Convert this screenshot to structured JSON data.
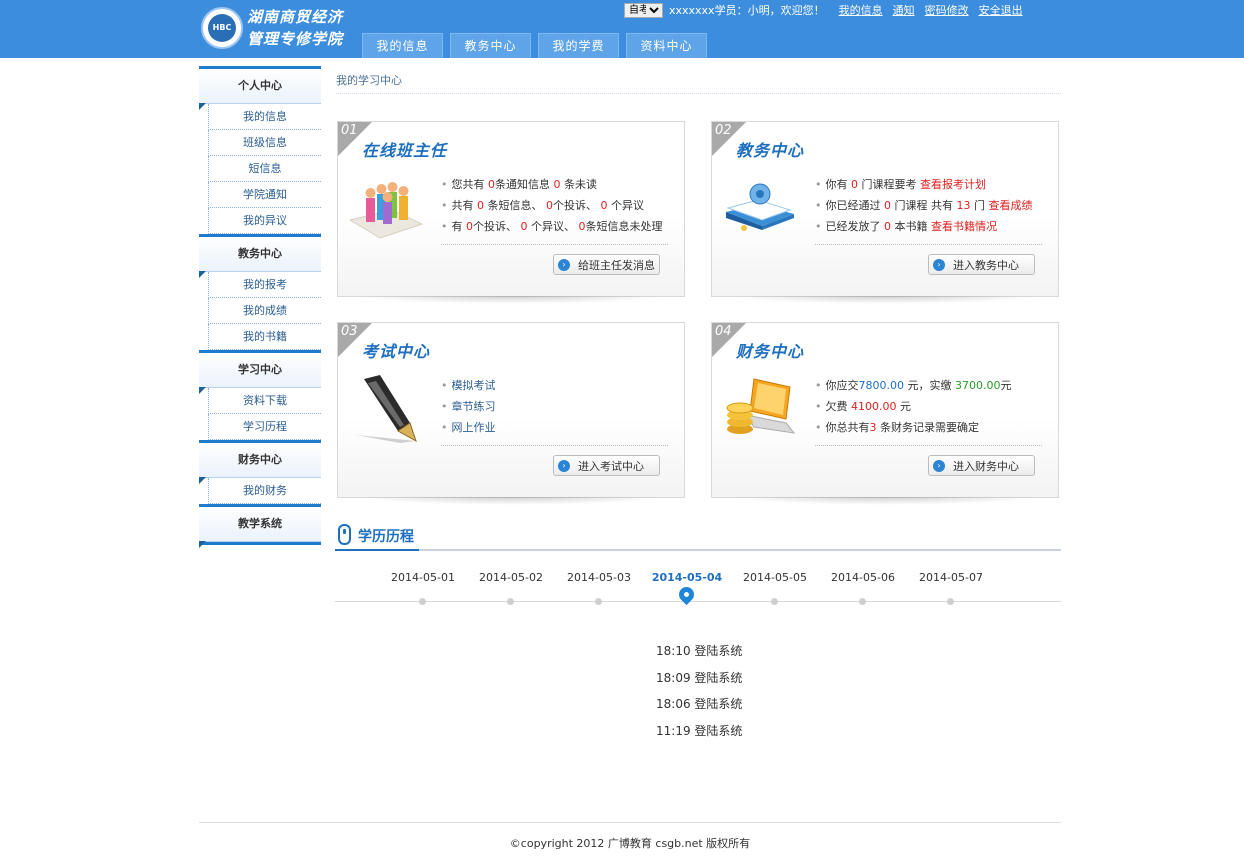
{
  "header": {
    "logo_badge": "HBC",
    "logo_title": "湖南商贸经济",
    "logo_subtitle": "管理专修学院",
    "exam_select": "自考",
    "greeting": "xxxxxxx学员：小明，欢迎您！",
    "links": [
      "我的信息",
      "通知",
      "密码修改",
      "安全退出"
    ],
    "nav_tabs": [
      "我的信息",
      "教务中心",
      "我的学费",
      "资料中心"
    ]
  },
  "sidebar": {
    "groups": [
      {
        "title": "个人中心",
        "items": [
          "我的信息",
          "班级信息",
          "短信息",
          "学院通知",
          "我的异议"
        ]
      },
      {
        "title": "教务中心",
        "items": [
          "我的报考",
          "我的成绩",
          "我的书籍"
        ]
      },
      {
        "title": "学习中心",
        "items": [
          "资料下载",
          "学习历程"
        ]
      },
      {
        "title": "财务中心",
        "items": [
          "我的财务"
        ]
      },
      {
        "title": "教学系统",
        "items": []
      }
    ]
  },
  "breadcrumb": "我的学习中心",
  "cards": {
    "c1": {
      "num": "01",
      "title": "在线班主任",
      "l1": {
        "a": "您共有 ",
        "b": "0",
        "c": "条通知信息 ",
        "d": "0",
        "e": " 条未读"
      },
      "l2": {
        "a": "共有 ",
        "b": "0",
        "c": " 条短信息、 ",
        "d": "0",
        "e": "个投诉、 ",
        "f": "0",
        "g": " 个异议"
      },
      "l3": {
        "a": "有 ",
        "b": "0",
        "c": "个投诉、 ",
        "d": "0",
        "e": " 个异议、 ",
        "f": "0",
        "g": "条短信息未处理"
      },
      "button": "给班主任发消息"
    },
    "c2": {
      "num": "02",
      "title": "教务中心",
      "l1": {
        "a": "你有 ",
        "b": "0",
        "c": " 门课程要考 ",
        "link": "查看报考计划"
      },
      "l2": {
        "a": "你已经通过 ",
        "b": "0",
        "c": " 门课程 共有 ",
        "d": "13",
        "e": " 门 ",
        "link": "查看成绩"
      },
      "l3": {
        "a": "已经发放了 ",
        "b": "0",
        "c": " 本书籍 ",
        "link": "查看书籍情况"
      },
      "button": "进入教务中心"
    },
    "c3": {
      "num": "03",
      "title": "考试中心",
      "items": [
        "模拟考试",
        "章节练习",
        "网上作业"
      ],
      "button": "进入考试中心"
    },
    "c4": {
      "num": "04",
      "title": "财务中心",
      "l1": {
        "a": "你应交",
        "b": "7800.00",
        "c": " 元，实缴 ",
        "d": "3700.00",
        "e": "元"
      },
      "l2": {
        "a": "欠费 ",
        "b": "4100.00",
        "c": " 元"
      },
      "l3": {
        "a": "你总共有",
        "b": "3",
        "c": " 条财务记录需要确定"
      },
      "button": "进入财务中心"
    }
  },
  "timeline": {
    "title": "学历历程",
    "dates": [
      "2014-05-01",
      "2014-05-02",
      "2014-05-03",
      "2014-05-04",
      "2014-05-05",
      "2014-05-06",
      "2014-05-07"
    ],
    "active_index": 3,
    "log": [
      "18:10 登陆系统",
      "18:09 登陆系统",
      "18:06 登陆系统",
      "11:19 登陆系统"
    ]
  },
  "footer": "©copyright 2012 广博教育 csgb.net 版权所有",
  "colors": {
    "header_bg": "#3c8dde",
    "accent": "#1f6fc0",
    "highlight_red": "#e02020"
  }
}
